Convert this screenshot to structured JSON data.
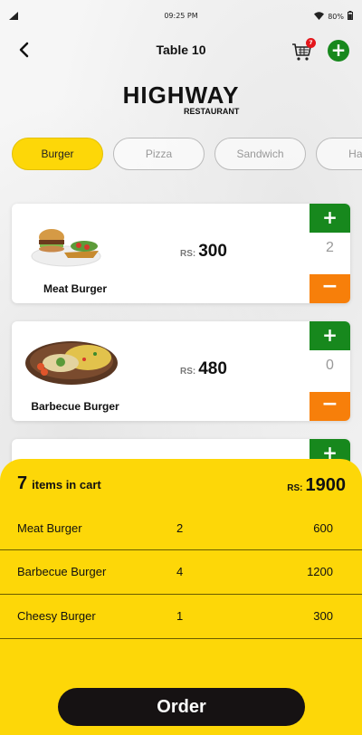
{
  "status_bar": {
    "time": "09:25 PM",
    "battery": "80%"
  },
  "header": {
    "title": "Table 10",
    "cart_badge": "7"
  },
  "brand": {
    "name": "HIGHWAY",
    "subtitle": "RESTAURANT"
  },
  "categories": [
    {
      "label": "Burger",
      "active": true
    },
    {
      "label": "Pizza",
      "active": false
    },
    {
      "label": "Sandwich",
      "active": false
    },
    {
      "label": "Hand",
      "active": false
    }
  ],
  "menu_items": [
    {
      "name": "Meat Burger",
      "currency": "RS:",
      "price": "300",
      "quantity": "2",
      "plus": "+",
      "minus": "−"
    },
    {
      "name": "Barbecue Burger",
      "currency": "RS:",
      "price": "480",
      "quantity": "0",
      "plus": "+",
      "minus": "−"
    }
  ],
  "partial_card": {
    "plus": "+"
  },
  "cart": {
    "count": "7",
    "count_label": "items in cart",
    "currency": "RS:",
    "total": "1900",
    "items": [
      {
        "name": "Meat Burger",
        "qty": "2",
        "price": "600"
      },
      {
        "name": "Barbecue Burger",
        "qty": "4",
        "price": "1200"
      },
      {
        "name": "Cheesy Burger",
        "qty": "1",
        "price": "300"
      }
    ],
    "order_label": "Order"
  },
  "colors": {
    "accent_yellow": "#fdd708",
    "add_green": "#17881d",
    "remove_orange": "#f77f0a",
    "badge_red": "#e4161b",
    "order_black": "#161213"
  }
}
